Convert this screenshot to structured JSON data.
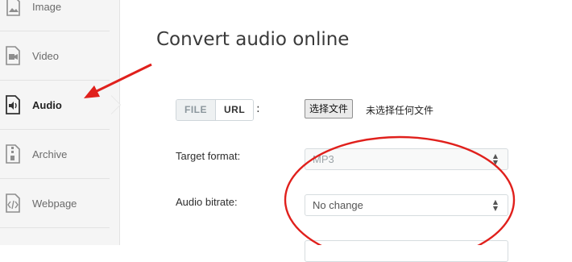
{
  "sidebar": {
    "items": [
      {
        "label": "Image",
        "icon": "image-icon"
      },
      {
        "label": "Video",
        "icon": "video-icon"
      },
      {
        "label": "Audio",
        "icon": "audio-icon",
        "active": true
      },
      {
        "label": "Archive",
        "icon": "archive-icon"
      },
      {
        "label": "Webpage",
        "icon": "webpage-icon"
      }
    ]
  },
  "main": {
    "title": "Convert audio online",
    "source_tabs": {
      "file": "FILE",
      "url": "URL",
      "colon": ":"
    },
    "file_input": {
      "button": "选择文件",
      "status": "未选择任何文件"
    },
    "fields": [
      {
        "label": "Target format:",
        "value": "MP3",
        "disabled": true
      },
      {
        "label": "Audio bitrate:",
        "value": "No change",
        "disabled": false
      }
    ]
  },
  "colors": {
    "annotation_red": "#e0201c",
    "sidebar_bg": "#f5f5f5"
  }
}
